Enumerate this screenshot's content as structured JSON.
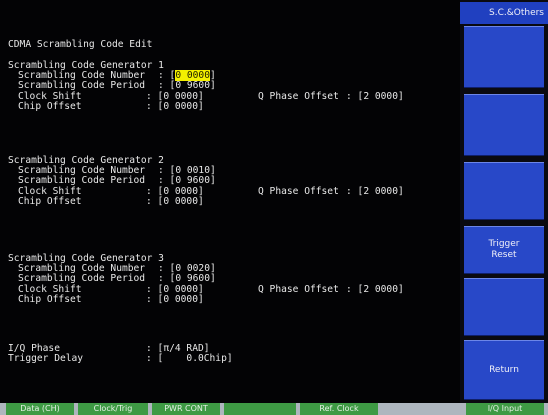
{
  "screen": {
    "title": "CDMA Scrambling Code Edit",
    "generators": [
      {
        "header": "Scrambling Code Generator 1",
        "number_label": "Scrambling Code Number",
        "number_prefix": ": [",
        "number_value": "0 0000",
        "number_suffix": "]",
        "period_label": "Scrambling Code Period",
        "period_value": ": [0 9600]",
        "clock_label": "Clock Shift",
        "clock_value": ": [0 0000]",
        "q_label": "Q Phase Offset",
        "q_value": ": [2 0000]",
        "chip_label": "Chip Offset",
        "chip_value": ": [0 0000]"
      },
      {
        "header": "Scrambling Code Generator 2",
        "number_label": "Scrambling Code Number",
        "number_value": ": [0 0010]",
        "period_label": "Scrambling Code Period",
        "period_value": ": [0 9600]",
        "clock_label": "Clock Shift",
        "clock_value": ": [0 0000]",
        "q_label": "Q Phase Offset",
        "q_value": ": [2 0000]",
        "chip_label": "Chip Offset",
        "chip_value": ": [0 0000]"
      },
      {
        "header": "Scrambling Code Generator 3",
        "number_label": "Scrambling Code Number",
        "number_value": ": [0 0020]",
        "period_label": "Scrambling Code Period",
        "period_value": ": [0 9600]",
        "clock_label": "Clock Shift",
        "clock_value": ": [0 0000]",
        "q_label": "Q Phase Offset",
        "q_value": ": [2 0000]",
        "chip_label": "Chip Offset",
        "chip_value": ": [0 0000]"
      }
    ],
    "iq_phase_label": "I/Q Phase",
    "iq_phase_value": ": [π/4 RAD]",
    "trigger_delay_label": "Trigger Delay",
    "trigger_delay_value": ": [    0.0Chip]"
  },
  "softkeys": {
    "top_label": "S.C.&Others",
    "trigger_reset": "Trigger\nReset",
    "return": "Return"
  },
  "bottom_tabs": [
    "Data (CH)",
    "Clock/Trig",
    "PWR CONT",
    "",
    "Ref. Clock",
    "I/Q Input"
  ],
  "colors": {
    "screen_bg": "#030305",
    "text": "#e8e8e8",
    "highlight": "#f4f000",
    "softkey": "#2848c8",
    "tab": "#3e9a44",
    "bezel": "#aeb6be"
  }
}
